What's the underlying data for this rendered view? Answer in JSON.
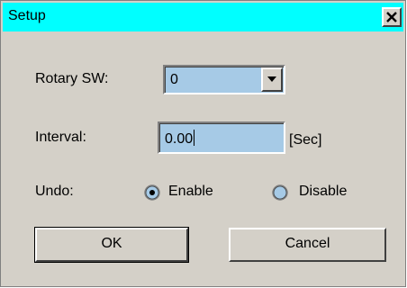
{
  "window": {
    "title": "Setup"
  },
  "rotary": {
    "label": "Rotary SW:",
    "value": "0"
  },
  "interval": {
    "label": "Interval:",
    "value": "0.00",
    "unit": "[Sec]"
  },
  "undo": {
    "label": "Undo:",
    "options": [
      {
        "label": "Enable",
        "selected": true
      },
      {
        "label": "Disable",
        "selected": false
      }
    ]
  },
  "buttons": {
    "ok": "OK",
    "cancel": "Cancel"
  },
  "colors": {
    "titlebar": "#00ffff",
    "field_bg": "#a6cae6",
    "face": "#d4d0c8"
  },
  "icons": {
    "close": "close-icon",
    "dropdown": "chevron-down-icon"
  }
}
